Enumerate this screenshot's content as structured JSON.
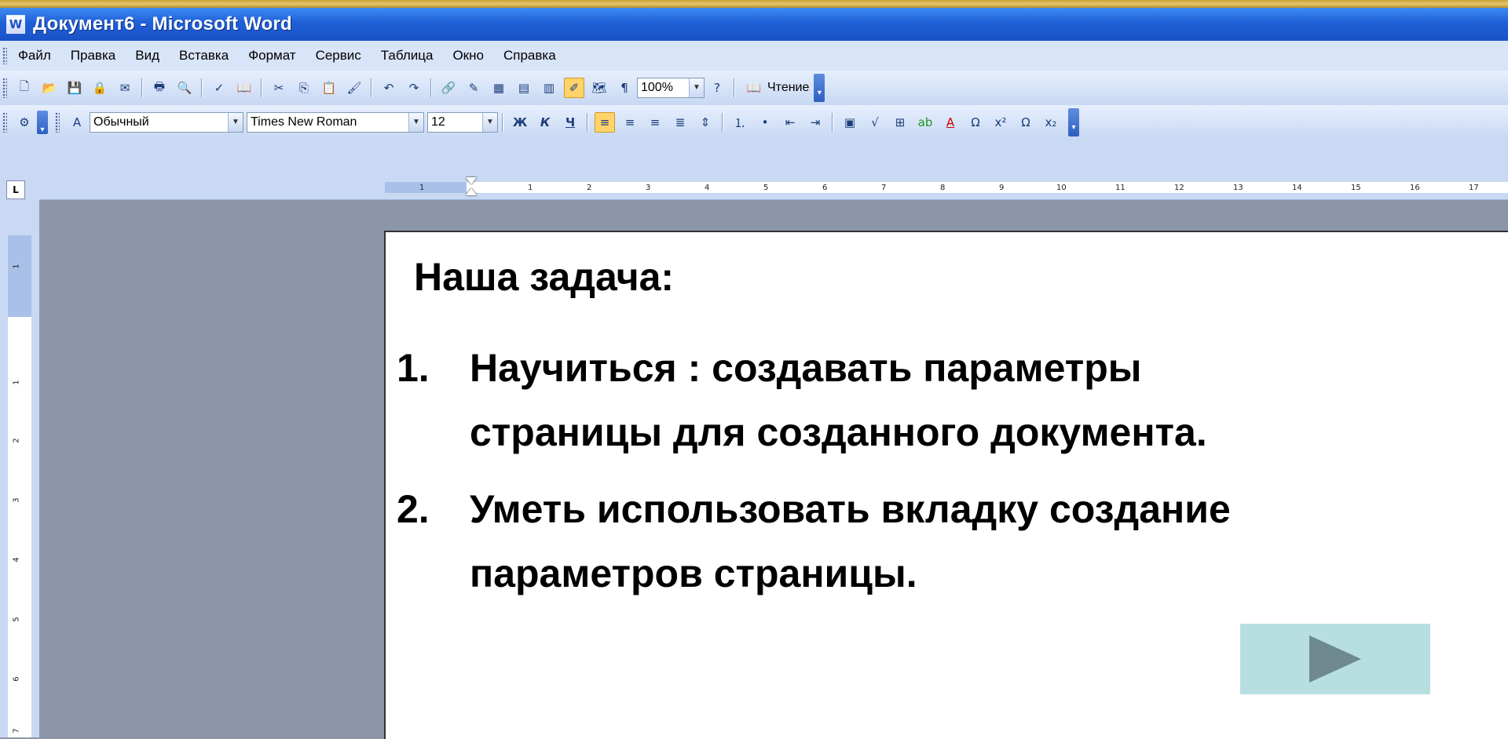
{
  "window": {
    "title": "Документ6 - Microsoft Word",
    "app_icon_glyph": "W"
  },
  "menu": [
    "Файл",
    "Правка",
    "Вид",
    "Вставка",
    "Формат",
    "Сервис",
    "Таблица",
    "Окно",
    "Справка"
  ],
  "toolbar_standard": {
    "zoom": "100%",
    "pilcrow": "¶",
    "read_label": "Чтение"
  },
  "toolbar_format": {
    "style": "Обычный",
    "font": "Times New Roman",
    "size": "12",
    "bold": "Ж",
    "italic": "К",
    "underline": "Ч",
    "omega": "Ω",
    "superscript": "x²",
    "subscript": "x₂"
  },
  "ruler": {
    "horizontal_ticks": [
      "1",
      "1",
      "2",
      "3",
      "4",
      "5",
      "6",
      "7",
      "8",
      "9",
      "10",
      "11",
      "12",
      "13",
      "14",
      "15",
      "16",
      "17"
    ],
    "vertical_ticks": [
      "1",
      "1",
      "2",
      "3",
      "4",
      "5",
      "6",
      "7"
    ],
    "tab_selector": "L"
  },
  "document": {
    "heading": "Наша задача:",
    "items": [
      {
        "number": "1.",
        "lines": [
          "Научиться : создавать параметры",
          "страницы для созданного документа."
        ]
      },
      {
        "number": "2.",
        "lines": [
          "Уметь использовать вкладку создание",
          "параметров страницы."
        ]
      }
    ]
  },
  "colors": {
    "title_bar": "#1f5fd8",
    "toolbar": "#c7d8f3",
    "workspace": "#8c96a8",
    "next_button": "#b7dfe1",
    "next_arrow": "#6e8a8e"
  }
}
